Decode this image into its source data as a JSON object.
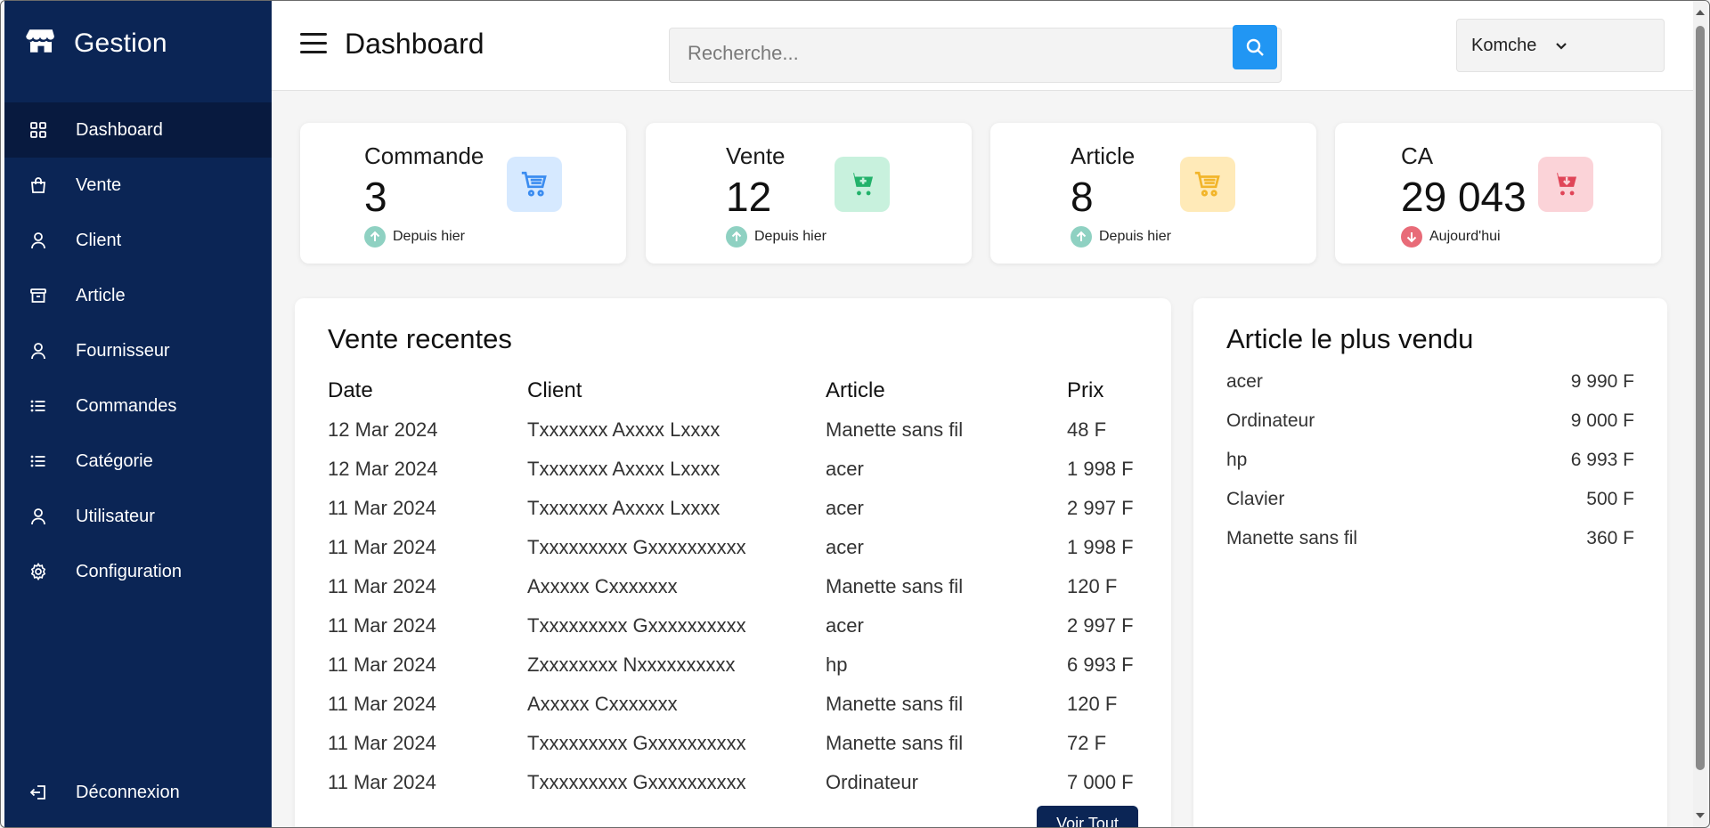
{
  "app": {
    "brand": "Gestion"
  },
  "sidebar": {
    "items": [
      {
        "label": "Dashboard",
        "icon": "grid-icon",
        "active": true
      },
      {
        "label": "Vente",
        "icon": "shopping-bag-icon"
      },
      {
        "label": "Client",
        "icon": "user-icon"
      },
      {
        "label": "Article",
        "icon": "archive-icon"
      },
      {
        "label": "Fournisseur",
        "icon": "user-icon"
      },
      {
        "label": "Commandes",
        "icon": "list-icon"
      },
      {
        "label": "Catégorie",
        "icon": "list-icon"
      },
      {
        "label": "Utilisateur",
        "icon": "user-icon"
      },
      {
        "label": "Configuration",
        "icon": "gear-icon"
      }
    ],
    "logout": "Déconnexion"
  },
  "header": {
    "title": "Dashboard",
    "search_placeholder": "Recherche...",
    "user": "Komche"
  },
  "stats": [
    {
      "label": "Commande",
      "value": "3",
      "trend": "Depuis hier",
      "direction": "up",
      "icon_color": "#3b8cf0",
      "icon_bg": "#d6e9ff"
    },
    {
      "label": "Vente",
      "value": "12",
      "trend": "Depuis hier",
      "direction": "up",
      "icon_color": "#23b26b",
      "icon_bg": "#c8f1dd"
    },
    {
      "label": "Article",
      "value": "8",
      "trend": "Depuis hier",
      "direction": "up",
      "icon_color": "#f2b52a",
      "icon_bg": "#ffeab8"
    },
    {
      "label": "CA",
      "value": "29 043",
      "trend": "Aujourd'hui",
      "direction": "down",
      "icon_color": "#e04558",
      "icon_bg": "#fbd3d8"
    }
  ],
  "colors": {
    "sidebar": "#0b2555",
    "accent": "#2196f3",
    "trend_up": "#8fd1c2",
    "trend_down": "#e86b78"
  },
  "recent_sales": {
    "title": "Vente recentes",
    "columns": [
      "Date",
      "Client",
      "Article",
      "Prix"
    ],
    "rows": [
      [
        "12 Mar 2024",
        "Txxxxxxx Axxxx Lxxxx",
        "Manette sans fil",
        "48 F"
      ],
      [
        "12 Mar 2024",
        "Txxxxxxx Axxxx Lxxxx",
        "acer",
        "1 998 F"
      ],
      [
        "11 Mar 2024",
        "Txxxxxxx Axxxx Lxxxx",
        "acer",
        "2 997 F"
      ],
      [
        "11 Mar 2024",
        "Txxxxxxxxx Gxxxxxxxxxx",
        "acer",
        "1 998 F"
      ],
      [
        "11 Mar 2024",
        "Axxxxx Cxxxxxxx",
        "Manette sans fil",
        "120 F"
      ],
      [
        "11 Mar 2024",
        "Txxxxxxxxx Gxxxxxxxxxx",
        "acer",
        "2 997 F"
      ],
      [
        "11 Mar 2024",
        "Zxxxxxxxx Nxxxxxxxxxx",
        "hp",
        "6 993 F"
      ],
      [
        "11 Mar 2024",
        "Axxxxx Cxxxxxxx",
        "Manette sans fil",
        "120 F"
      ],
      [
        "11 Mar 2024",
        "Txxxxxxxxx Gxxxxxxxxxx",
        "Manette sans fil",
        "72 F"
      ],
      [
        "11 Mar 2024",
        "Txxxxxxxxx Gxxxxxxxxxx",
        "Ordinateur",
        "7 000 F"
      ]
    ],
    "button": "Voir Tout"
  },
  "best_selling": {
    "title": "Article le plus vendu",
    "items": [
      {
        "name": "acer",
        "value": "9 990 F"
      },
      {
        "name": "Ordinateur",
        "value": "9 000 F"
      },
      {
        "name": "hp",
        "value": "6 993 F"
      },
      {
        "name": "Clavier",
        "value": "500 F"
      },
      {
        "name": "Manette sans fil",
        "value": "360 F"
      }
    ]
  }
}
